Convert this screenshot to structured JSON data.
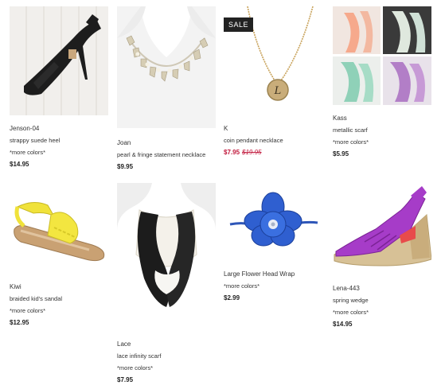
{
  "products": [
    {
      "name": "Jenson-04",
      "desc": "strappy suede heel",
      "colors": "*more colors*",
      "price": "$14.95"
    },
    {
      "name": "Joan",
      "desc": "pearl & fringe statement necklace",
      "colors": "",
      "price": "$9.95"
    },
    {
      "name": "K",
      "desc": "coin pendant necklace",
      "colors": "",
      "price": "$7.95",
      "original_price": "$19.95",
      "badge": "SALE"
    },
    {
      "name": "Kass",
      "desc": "metallic scarf",
      "colors": "*more colors*",
      "price": "$5.95"
    },
    {
      "name": "Kiwi",
      "desc": "braided kid's sandal",
      "colors": "*more colors*",
      "price": "$12.95"
    },
    {
      "name": "Lace",
      "desc": "lace infinity scarf",
      "colors": "*more colors*",
      "price": "$7.95"
    },
    {
      "name": "Large Flower Head Wrap",
      "desc": "",
      "colors": "*more colors*",
      "price": "$2.99"
    },
    {
      "name": "Lena-443",
      "desc": "spring wedge",
      "colors": "*more colors*",
      "price": "$14.95"
    }
  ]
}
